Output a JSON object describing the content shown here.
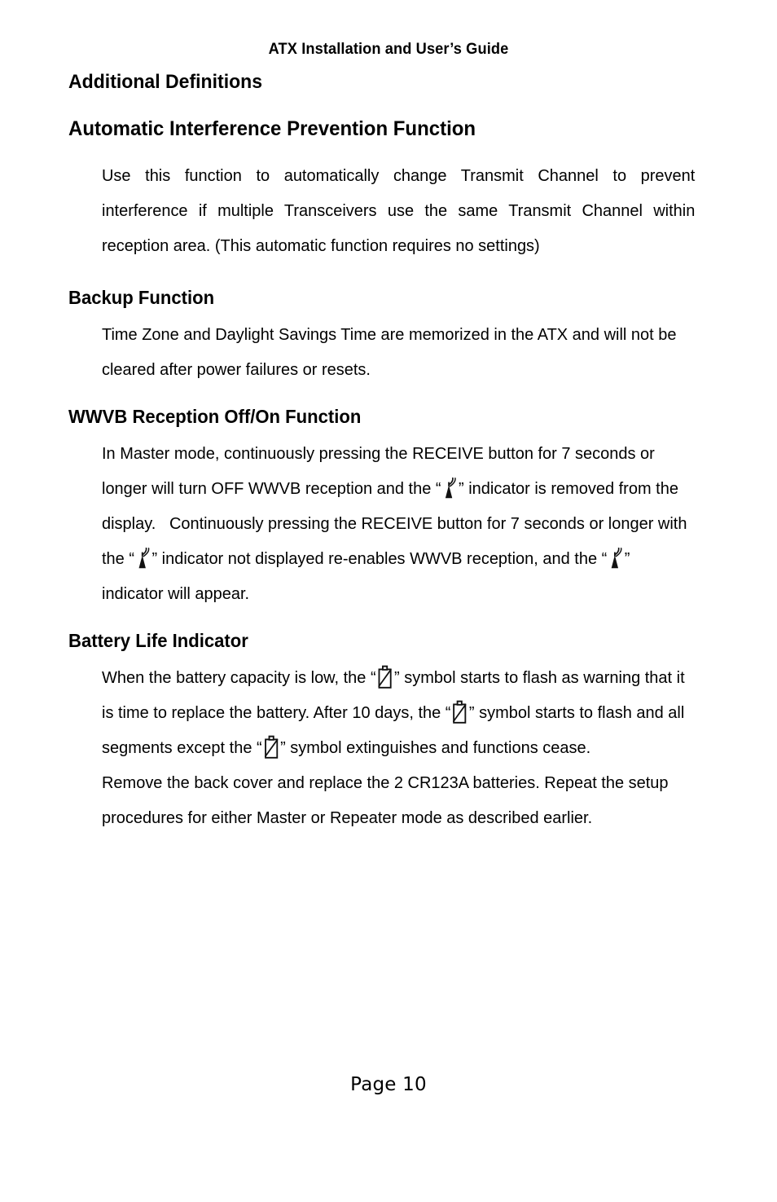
{
  "document": {
    "running_header": "ATX Installation and User’s Guide",
    "footer": "Page 10"
  },
  "icons": {
    "antenna": "antenna-signal-icon",
    "battery": "low-battery-icon"
  },
  "sections": {
    "additional_definitions": {
      "title": "Additional Definitions"
    },
    "auto_interference": {
      "title": "Automatic Interference Prevention Function",
      "paragraph": "Use this function to automatically change Transmit Channel to prevent interference if multiple Transceivers use the same Transmit Channel within reception area. (This automatic function requires no settings)"
    },
    "backup_function": {
      "title": "Backup Function",
      "paragraph": "Time Zone and Daylight Savings Time are memorized in the ATX and will not be cleared after power failures or resets."
    },
    "wwvb": {
      "title": "WWVB Reception Off/On Function",
      "part1": "In Master mode, continuously pressing the RECEIVE button for 7 seconds or longer will turn OFF WWVB reception and the “",
      "part2": "” indicator is removed from the display.   Continuously pressing the RECEIVE button for 7 seconds or longer with the “",
      "part3": "” indicator not displayed re-enables WWVB reception, and the “",
      "part4": "” indicator will appear."
    },
    "battery_life": {
      "title": "Battery Life Indicator",
      "part1": "When the battery capacity is low, the “",
      "part2": "” symbol starts to flash as warning that it is time to replace the battery. After 10 days, the “",
      "part3": "” symbol starts to flash and all segments except the “",
      "part4": "” symbol extinguishes and functions cease.",
      "paragraph2": "Remove the back cover and replace the 2 CR123A batteries. Repeat the setup procedures for either Master or Repeater mode as described earlier."
    }
  }
}
